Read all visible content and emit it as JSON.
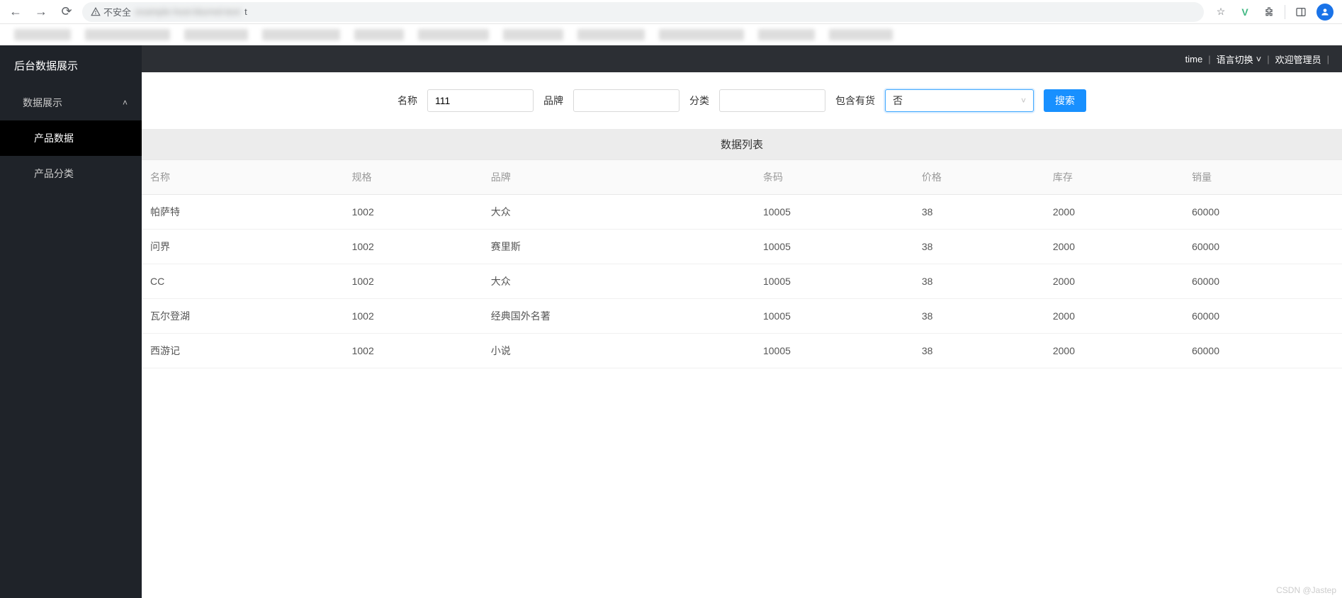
{
  "browser": {
    "insecure_label": "不安全",
    "url_text": "t"
  },
  "sidebar": {
    "title": "后台数据展示",
    "items": [
      {
        "label": "数据展示",
        "expanded": true,
        "children": [
          {
            "label": "产品数据",
            "active": true
          },
          {
            "label": "产品分类",
            "active": false
          }
        ]
      }
    ]
  },
  "header": {
    "time": "time",
    "lang": "语言切换",
    "welcome": "欢迎管理员"
  },
  "search": {
    "name_label": "名称",
    "name_value": "111",
    "brand_label": "品牌",
    "brand_value": "",
    "category_label": "分类",
    "category_value": "",
    "instock_label": "包含有货",
    "instock_value": "否",
    "button": "搜索"
  },
  "table": {
    "title": "数据列表",
    "columns": [
      "名称",
      "规格",
      "品牌",
      "条码",
      "价格",
      "库存",
      "销量"
    ],
    "rows": [
      {
        "name": "帕萨特",
        "spec": "1002",
        "brand": "大众",
        "barcode": "10005",
        "price": "38",
        "stock": "2000",
        "sales": "60000"
      },
      {
        "name": "问界",
        "spec": "1002",
        "brand": "赛里斯",
        "barcode": "10005",
        "price": "38",
        "stock": "2000",
        "sales": "60000"
      },
      {
        "name": "CC",
        "spec": "1002",
        "brand": "大众",
        "barcode": "10005",
        "price": "38",
        "stock": "2000",
        "sales": "60000"
      },
      {
        "name": "瓦尔登湖",
        "spec": "1002",
        "brand": "经典国外名著",
        "barcode": "10005",
        "price": "38",
        "stock": "2000",
        "sales": "60000"
      },
      {
        "name": "西游记",
        "spec": "1002",
        "brand": "小说",
        "barcode": "10005",
        "price": "38",
        "stock": "2000",
        "sales": "60000"
      }
    ]
  },
  "watermark": "CSDN @Jastep"
}
